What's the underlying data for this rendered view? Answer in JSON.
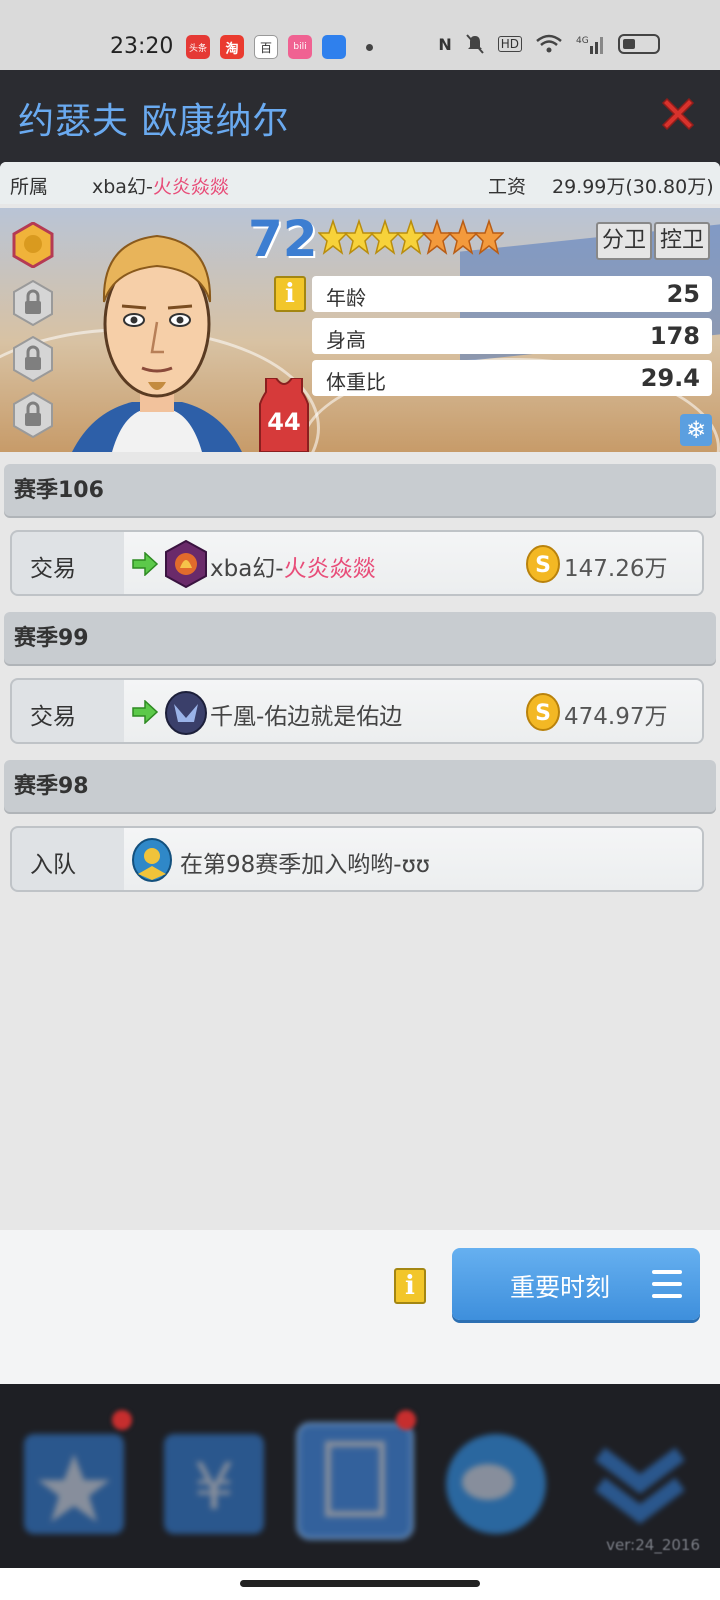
{
  "status_bar": {
    "time": "23:20",
    "apps": [
      {
        "name": "news-app-icon",
        "color": "#e53935",
        "text": "头条"
      },
      {
        "name": "taobao-icon",
        "color": "#ea3b2f",
        "text": "淘"
      },
      {
        "name": "baidu-icon",
        "color": "#ffffff",
        "text": "百"
      },
      {
        "name": "bilibili-icon",
        "color": "#f06292",
        "text": "bili"
      },
      {
        "name": "blue-app-icon",
        "color": "#2f80ed",
        "text": ""
      }
    ],
    "right": [
      "NFC",
      "mute",
      "HD",
      "wifi",
      "4G",
      "signal",
      "battery"
    ]
  },
  "header": {
    "title": "约瑟夫 欧康纳尔",
    "close_icon": "close-icon"
  },
  "player": {
    "team_label": "所属",
    "team_prefix": "xba幻-",
    "team_name": "火炎焱燚",
    "salary_label": "工资",
    "salary_value": "29.99万(30.80万)",
    "rating": "72",
    "star_count": 7,
    "gold_stars": 4,
    "positions": [
      "分卫",
      "控卫"
    ],
    "stats": [
      {
        "label": "年龄",
        "value": "25"
      },
      {
        "label": "身高",
        "value": "178"
      },
      {
        "label": "体重比",
        "value": "29.4"
      }
    ],
    "jersey_number": "44",
    "colors": {
      "rating": "#3d7ed1",
      "jersey": "#d63a3a",
      "team_highlight": "#e84d79"
    }
  },
  "seasons": [
    {
      "title": "赛季106",
      "event": {
        "type": "交易",
        "team_prefix": "xba幻-",
        "team_name": "火炎焱燚",
        "amount": "147.26万"
      }
    },
    {
      "title": "赛季99",
      "event": {
        "type": "交易",
        "team_prefix": "",
        "team_name": "千凰-佑边就是佑边",
        "amount": "474.97万"
      }
    },
    {
      "title": "赛季98",
      "event": {
        "type": "入队",
        "description": "在第98赛季加入哟哟-ʊʊ"
      }
    }
  ],
  "actions": {
    "moments_label": "重要时刻"
  },
  "nav": {
    "version": "ver:24_2016"
  }
}
